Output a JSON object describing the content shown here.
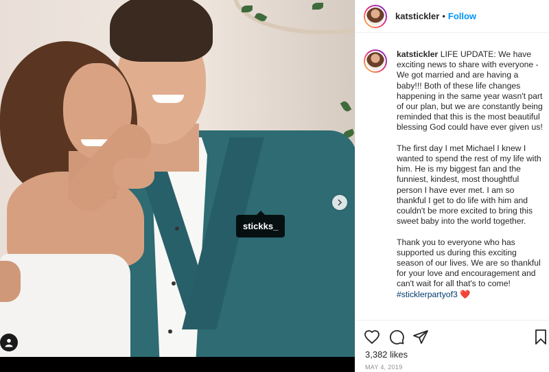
{
  "post": {
    "username": "katstickler",
    "separator": "•",
    "follow_label": "Follow",
    "tagged_user": "stickks_"
  },
  "caption": {
    "username": "katstickler",
    "paragraph_1": "LIFE UPDATE: We have exciting news to share with everyone - We got married and are having a baby!!! Both of these life changes happening in the same year wasn't part of our plan, but we are constantly being reminded that this is the most beautiful blessing God could have ever given us!",
    "paragraph_2": "The first day I met Michael I knew I wanted to spend the rest of my life with him. He is my biggest fan and the funniest, kindest, most thoughtful person I have ever met. I am so thankful I get to do life with him and couldn't be more excited to bring this sweet baby into the world together.",
    "paragraph_3": "Thank you to everyone who has supported us during this exciting season of our lives. We are so thankful for your love and encouragement and can't wait for all that's to come!",
    "hashtag": "#sticklerpartyof3",
    "emoji": "❤️"
  },
  "engagement": {
    "likes": "3,382 likes",
    "date": "MAY 4, 2019"
  },
  "icons": [
    "next-arrow-icon",
    "user-tag-icon",
    "heart-icon",
    "comment-icon",
    "share-icon",
    "bookmark-icon"
  ],
  "colors": {
    "follow_blue": "#0095f6",
    "hashtag_blue": "#00376b",
    "jacket_teal": "#2e6b73",
    "date_gray": "#8e8e8e"
  }
}
